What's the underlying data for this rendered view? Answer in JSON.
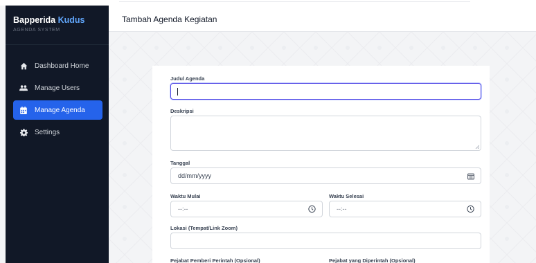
{
  "brand": {
    "name": "Bapperida",
    "accent": "Kudus",
    "subtitle": "AGENDA SYSTEM"
  },
  "sidebar": {
    "items": [
      {
        "label": "Dashboard Home",
        "icon": "home-icon",
        "active": false
      },
      {
        "label": "Manage Users",
        "icon": "users-icon",
        "active": false
      },
      {
        "label": "Manage Agenda",
        "icon": "calendar-icon",
        "active": true
      },
      {
        "label": "Settings",
        "icon": "gear-icon",
        "active": false
      }
    ]
  },
  "header": {
    "title": "Tambah Agenda Kegiatan"
  },
  "form": {
    "judul": {
      "label": "Judul Agenda",
      "value": ""
    },
    "deskripsi": {
      "label": "Deskripsi",
      "value": ""
    },
    "tanggal": {
      "label": "Tanggal",
      "placeholder": "dd/mm/yyyy"
    },
    "waktu_mulai": {
      "label": "Waktu Mulai",
      "placeholder": "--:--"
    },
    "waktu_selesai": {
      "label": "Waktu Selesai",
      "placeholder": "--:--"
    },
    "lokasi": {
      "label": "Lokasi (Tempat/Link Zoom)",
      "value": ""
    },
    "pejabat_pemberi": {
      "label": "Pejabat Pemberi Perintah (Opsional)"
    },
    "pejabat_diperintah": {
      "label": "Pejabat yang Diperintah (Opsional)"
    }
  },
  "colors": {
    "sidebar_bg": "#111827",
    "accent": "#2563eb",
    "brand_accent": "#60a5fa",
    "focus": "#4f46e5"
  }
}
